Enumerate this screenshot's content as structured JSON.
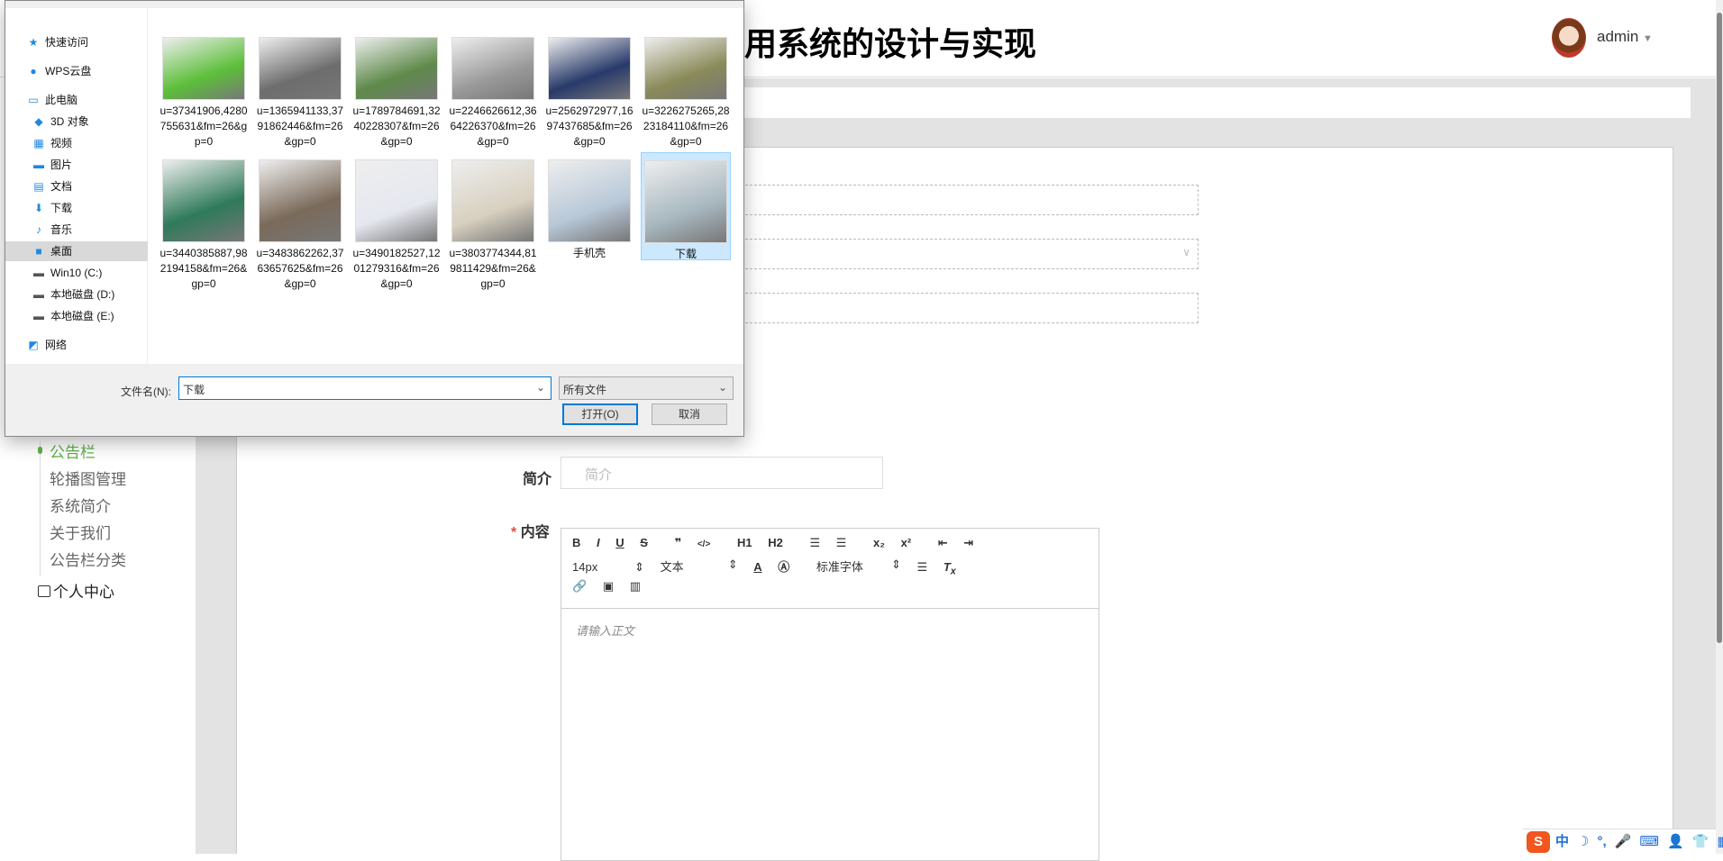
{
  "header": {
    "title": "用系统的设计与实现",
    "user": "admin",
    "dropdown_icon": "caret-down-icon"
  },
  "sidebar": {
    "items": [
      {
        "label": "公告栏",
        "active": true
      },
      {
        "label": "轮播图管理"
      },
      {
        "label": "系统简介"
      },
      {
        "label": "关于我们"
      },
      {
        "label": "公告栏分类"
      }
    ],
    "personal": "个人中心"
  },
  "form": {
    "intro_label": "简介",
    "intro_placeholder": "简介",
    "content_label": "内容",
    "required_mark": "*",
    "editor": {
      "row1": [
        "B",
        "I",
        "U",
        "S",
        "❞",
        "</>",
        "H1",
        "H2",
        "ol",
        "ul",
        "x₂",
        "x²",
        "outdent",
        "indent"
      ],
      "font_size": "14px",
      "text_type": "文本",
      "font_family": "标准字体",
      "placeholder": "请输入正文"
    }
  },
  "dialog": {
    "nav": [
      {
        "label": "快速访问",
        "icon": "star-icon"
      },
      {
        "label": "WPS云盘",
        "icon": "cloud-icon"
      },
      {
        "label": "此电脑",
        "icon": "computer-icon"
      },
      {
        "label": "3D 对象",
        "icon": "cube-icon"
      },
      {
        "label": "视频",
        "icon": "video-icon"
      },
      {
        "label": "图片",
        "icon": "picture-icon"
      },
      {
        "label": "文档",
        "icon": "document-icon"
      },
      {
        "label": "下载",
        "icon": "download-icon"
      },
      {
        "label": "音乐",
        "icon": "music-icon"
      },
      {
        "label": "桌面",
        "icon": "desktop-icon",
        "selected": true
      },
      {
        "label": "Win10 (C:)",
        "icon": "drive-icon"
      },
      {
        "label": "本地磁盘 (D:)",
        "icon": "drive-icon"
      },
      {
        "label": "本地磁盘 (E:)",
        "icon": "drive-icon"
      },
      {
        "label": "网络",
        "icon": "network-icon"
      }
    ],
    "files": [
      {
        "name": "u=37341906,4280755631&fm=26&gp=0",
        "color": "#5cbf3a"
      },
      {
        "name": "u=1365941133,3791862446&fm=26&gp=0",
        "color": "#6d6d6d"
      },
      {
        "name": "u=1789784691,3240228307&fm=26&gp=0",
        "color": "#5e8a4a"
      },
      {
        "name": "u=2246626612,3664226370&fm=26&gp=0",
        "color": "#9a9a9a"
      },
      {
        "name": "u=2562972977,1697437685&fm=26&gp=0",
        "color": "#283a6a"
      },
      {
        "name": "u=3226275265,2823184110&fm=26&gp=0",
        "color": "#8a8a5a"
      },
      {
        "name": "u=3440385887,982194158&fm=26&gp=0",
        "color": "#2f7a5a"
      },
      {
        "name": "u=3483862262,3763657625&fm=26&gp=0",
        "color": "#7a6a5a"
      },
      {
        "name": "u=3490182527,1201279316&fm=26&gp=0",
        "color": "#e6e8f0"
      },
      {
        "name": "u=3803774344,819811429&fm=26&gp=0",
        "color": "#d8d0c0"
      },
      {
        "name": "手机壳",
        "color": "#b8c8d8"
      },
      {
        "name": "下载",
        "color": "#a8b8c0",
        "selected": true
      }
    ],
    "filename_label": "文件名(N):",
    "filename_value": "下载",
    "filter": "所有文件",
    "open_label": "打开(O)",
    "cancel_label": "取消"
  },
  "ime": {
    "logo": "S",
    "items": [
      "中",
      "☽",
      "°,",
      "🎤",
      "⌨",
      "👤",
      "👕",
      "▦"
    ]
  }
}
